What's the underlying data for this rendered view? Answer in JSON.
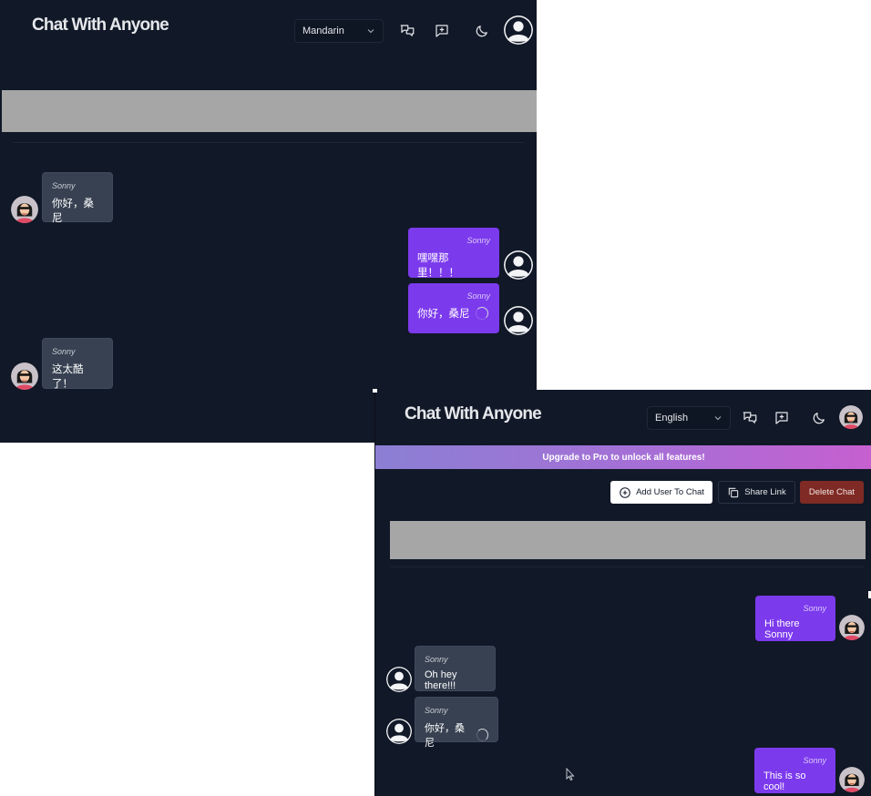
{
  "app": {
    "logo_text": "Chat With Anyone"
  },
  "window_a": {
    "language": "Mandarin",
    "messages": [
      {
        "sender": "Sonny",
        "text": "你好，桑尼",
        "side": "left",
        "avatar": "woman"
      },
      {
        "sender": "Sonny",
        "text": "嘿嘿那里！！！",
        "side": "right",
        "avatar": "user"
      },
      {
        "sender": "Sonny",
        "text": "你好，桑尼",
        "side": "right",
        "avatar": "user",
        "loading": true
      },
      {
        "sender": "Sonny",
        "text": "这太酷了！",
        "side": "left",
        "avatar": "woman"
      }
    ]
  },
  "window_b": {
    "language": "English",
    "upgrade_banner": "Upgrade to Pro to unlock all features!",
    "actions": {
      "add_user": "Add User To Chat",
      "share_link": "Share Link",
      "delete_chat": "Delete Chat"
    },
    "messages": [
      {
        "sender": "Sonny",
        "text": "Hi there Sonny",
        "side": "right",
        "avatar": "woman"
      },
      {
        "sender": "Sonny",
        "text": "Oh hey there!!!",
        "side": "left",
        "avatar": "user"
      },
      {
        "sender": "Sonny",
        "text": "你好，桑尼",
        "side": "left",
        "avatar": "user",
        "loading": true
      },
      {
        "sender": "Sonny",
        "text": "This is so cool!",
        "side": "right",
        "avatar": "woman"
      }
    ]
  },
  "icons": {
    "translate": "translate-icon",
    "new_chat": "message-plus-icon",
    "theme": "moon-icon",
    "add_user": "plus-circle-icon",
    "share": "copy-icon",
    "dropdown": "chevron-down-icon"
  },
  "colors": {
    "background": "#111827",
    "bubble_other": "#374151",
    "bubble_me": "#7c3aed",
    "delete": "#7f2a24"
  }
}
